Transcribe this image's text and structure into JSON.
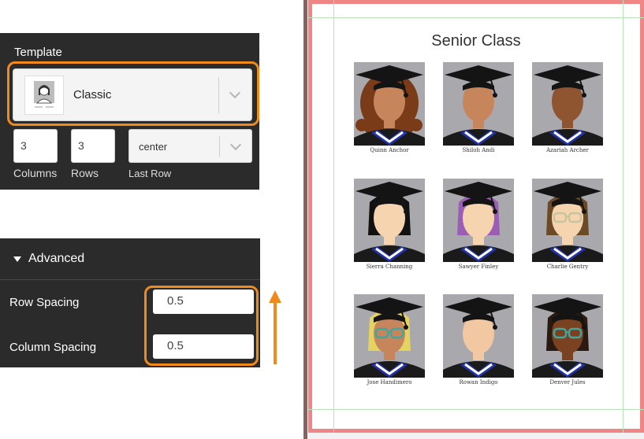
{
  "template_panel": {
    "title": "Template",
    "selected_template": "Classic",
    "columns_value": "3",
    "rows_value": "3",
    "last_row_value": "center",
    "columns_label": "Columns",
    "rows_label": "Rows",
    "last_row_label": "Last Row"
  },
  "advanced_panel": {
    "title": "Advanced",
    "row_spacing_label": "Row Spacing",
    "row_spacing_value": "0.5",
    "column_spacing_label": "Column Spacing",
    "column_spacing_value": "0.5"
  },
  "preview": {
    "title": "Senior Class",
    "students": [
      {
        "name": "Quinn Anchor"
      },
      {
        "name": "Shiloh Andi"
      },
      {
        "name": "Azariah Archer"
      },
      {
        "name": "Sierra Channing"
      },
      {
        "name": "Sawyer Finley"
      },
      {
        "name": "Charlie Gentry"
      },
      {
        "name": "Jose Handimero"
      },
      {
        "name": "Rowan Indigo"
      },
      {
        "name": "Denver Jules"
      }
    ]
  },
  "colors": {
    "panel_bg": "#2b2b2b",
    "highlight": "#f08a1c",
    "page_border": "#ef8585",
    "guides": "#b9e2b9",
    "photo_bg": "#a8a8ad",
    "cap": "#141414",
    "stole": "#2233aa"
  },
  "icons": [
    "chevron-down-icon",
    "caret-down-icon",
    "arrow-up-icon",
    "template-thumbnail-icon"
  ]
}
